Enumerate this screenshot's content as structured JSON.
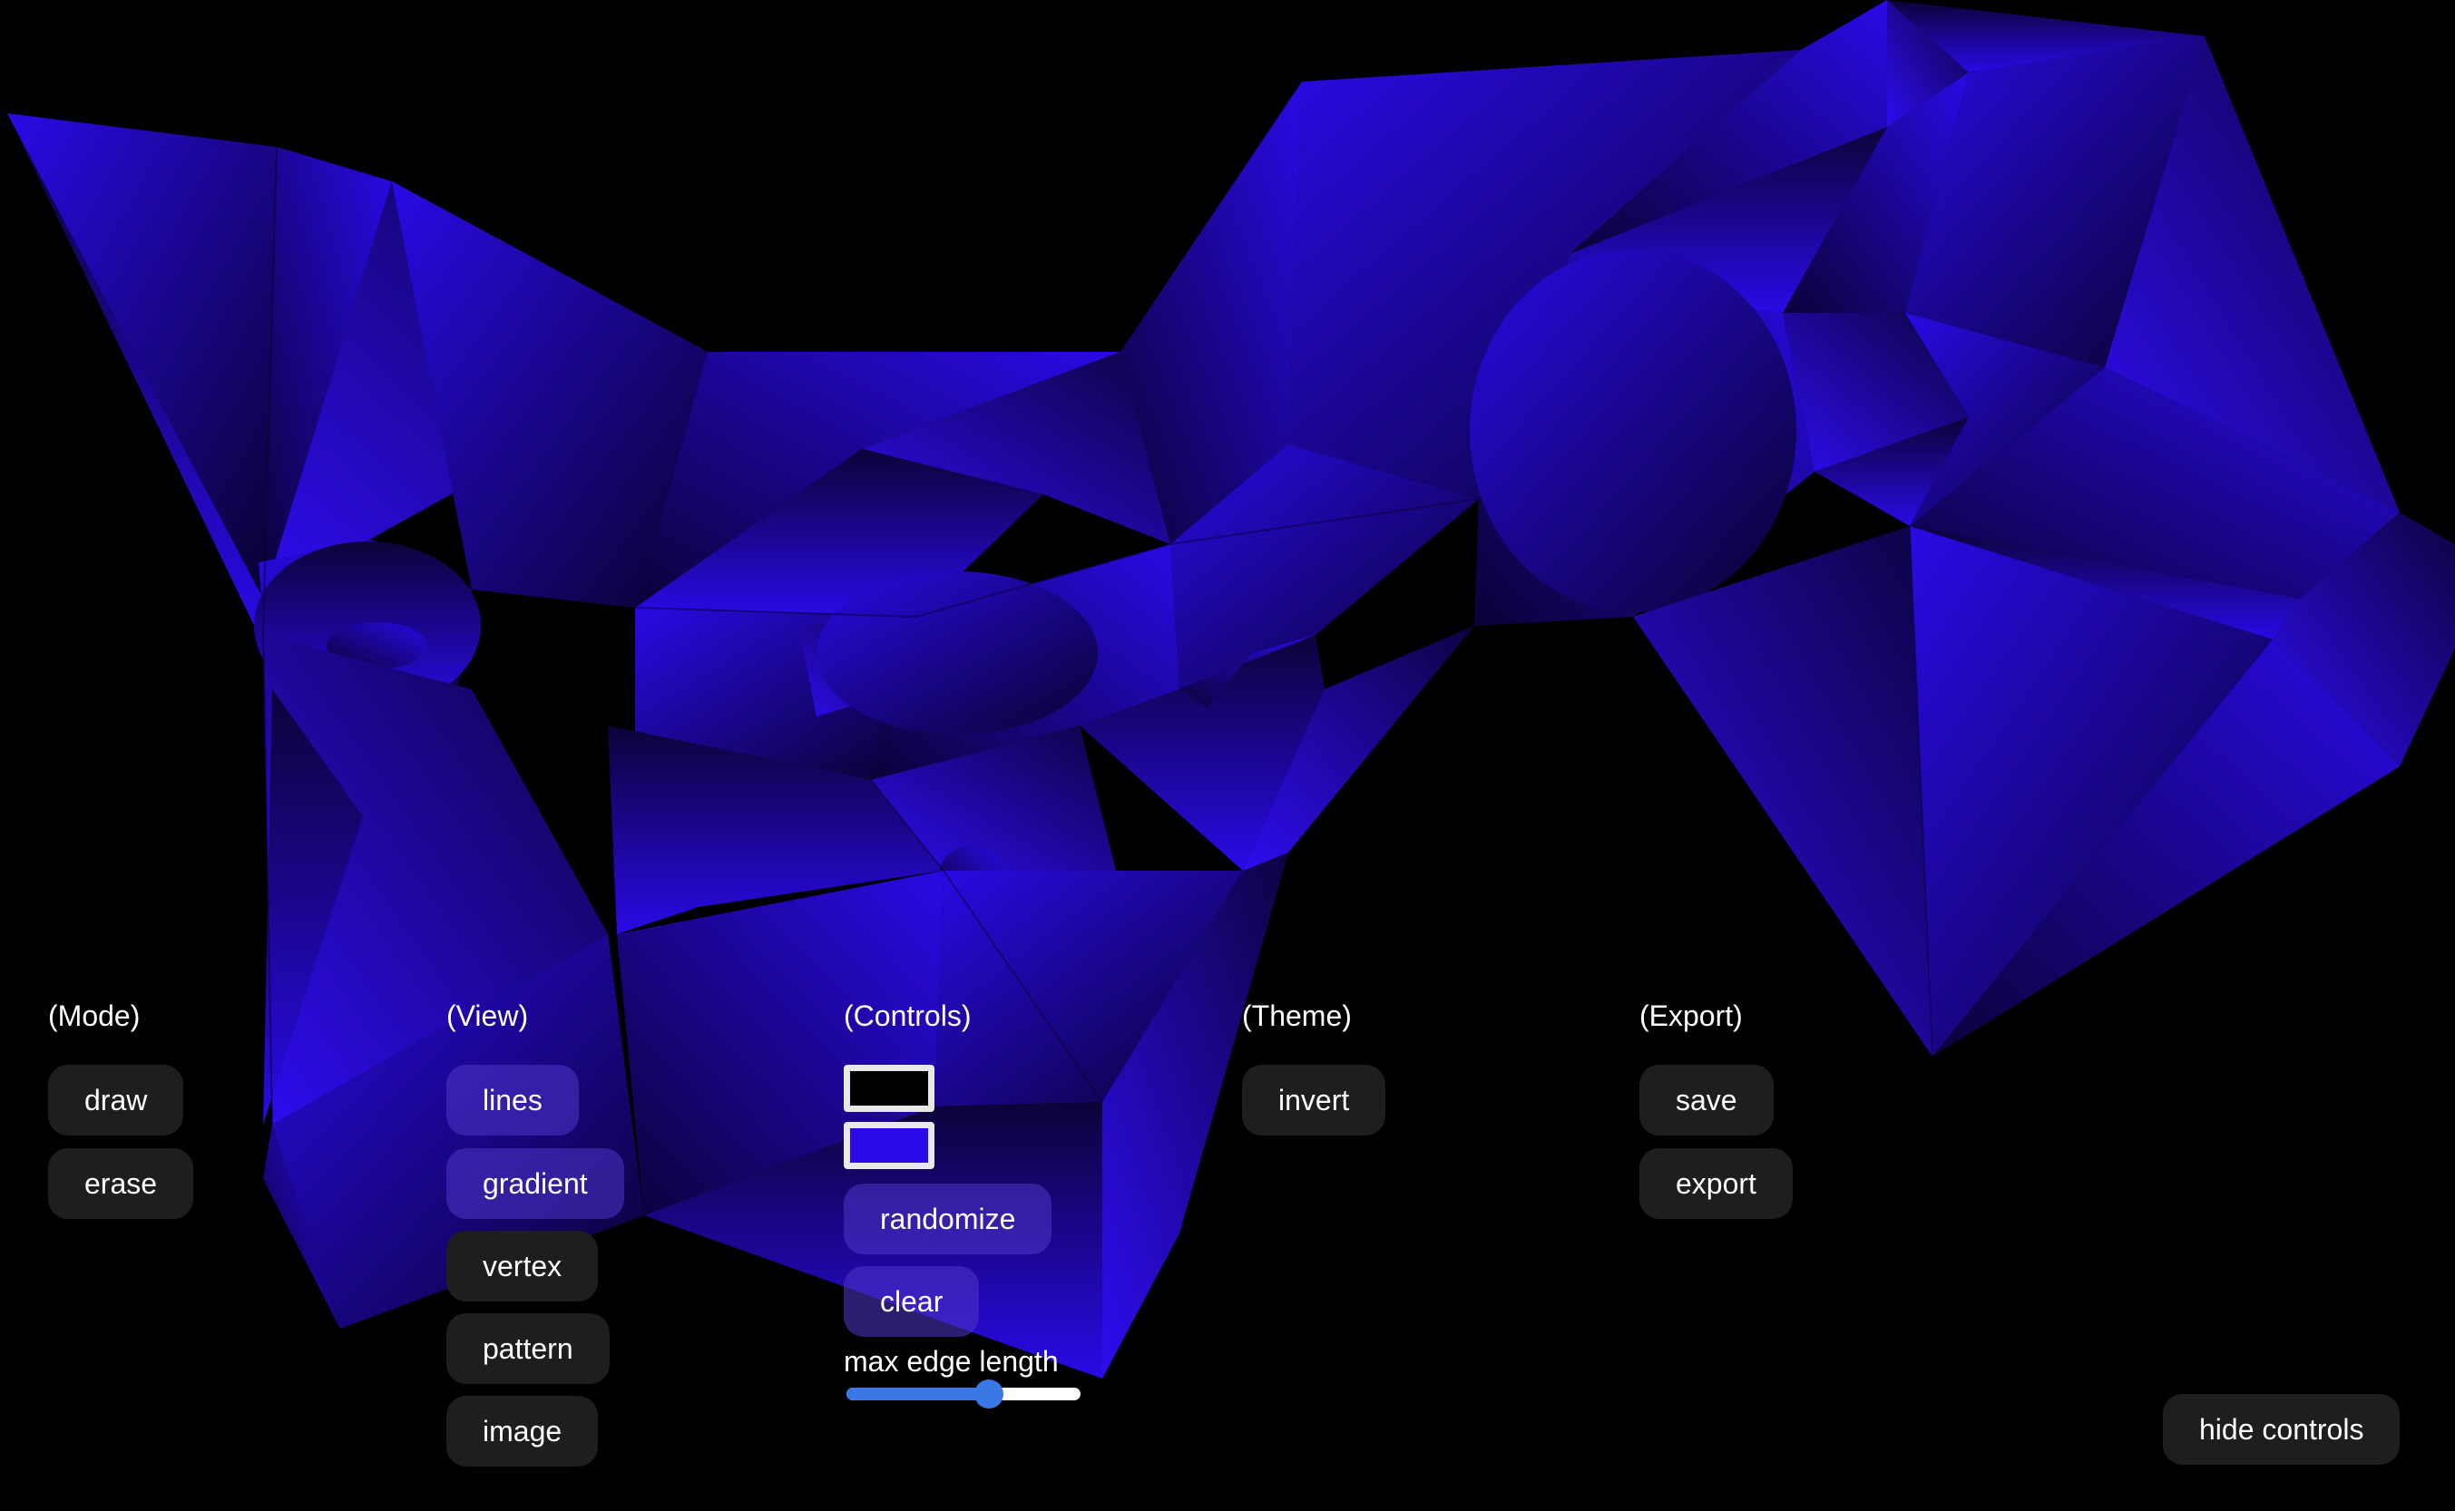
{
  "colors": {
    "background": "#000000",
    "fill": "#2a0ae6",
    "button_bg": "#1e1e1e",
    "button_active_bg": "#3e2aa0",
    "slider_accent": "#3b78e7"
  },
  "mode": {
    "label": "(Mode)",
    "draw_label": "draw",
    "erase_label": "erase"
  },
  "view": {
    "label": "(View)",
    "lines_label": "lines",
    "gradient_label": "gradient",
    "vertex_label": "vertex",
    "pattern_label": "pattern",
    "image_label": "image"
  },
  "controls": {
    "label": "(Controls)",
    "background_color": "#000000",
    "foreground_color": "#2a0ae6",
    "randomize_label": "randomize",
    "clear_label": "clear",
    "slider_label": "max edge length",
    "slider_value": 0.61
  },
  "theme": {
    "label": "(Theme)",
    "invert_label": "invert"
  },
  "export": {
    "label": "(Export)",
    "save_label": "save",
    "export_label": "export"
  },
  "footer": {
    "hide_controls_label": "hide controls"
  }
}
